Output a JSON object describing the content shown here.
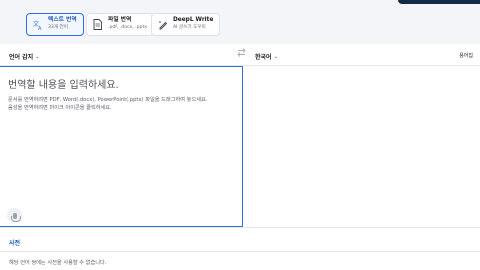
{
  "modes": [
    {
      "title": "텍스트 번역",
      "subtitle": "33개 언어",
      "icon": "translate-icon"
    },
    {
      "title": "파일 번역",
      "subtitle": ".pdf, .docx, .pptx",
      "icon": "document-icon"
    },
    {
      "title": "DeepL Write",
      "subtitle": "AI 글쓰기 도우미",
      "icon": "write-icon"
    }
  ],
  "language_bar": {
    "source_language": "언어 감지",
    "target_language": "한국어",
    "glossary_label": "용어집",
    "swap_icon": "swap-arrows-icon"
  },
  "source_pane": {
    "placeholder": "번역할 내용을 입력하세요.",
    "hint_line1": "문서를 번역하려면 PDF, Word(.docx), PowerPoint(.pptx) 파일을 드래그하여 놓으세요.",
    "hint_line2": "음성을 번역하려면 마이크 아이콘을 클릭하세요.",
    "mic_icon": "microphone-icon"
  },
  "dictionary": {
    "title": "사전",
    "message": "해당 언어 쌍에는 사전을 사용할 수 없습니다."
  },
  "colors": {
    "accent": "#2f6fd8",
    "brand_dark": "#0f2b46",
    "top_background": "#f3f5f8"
  }
}
